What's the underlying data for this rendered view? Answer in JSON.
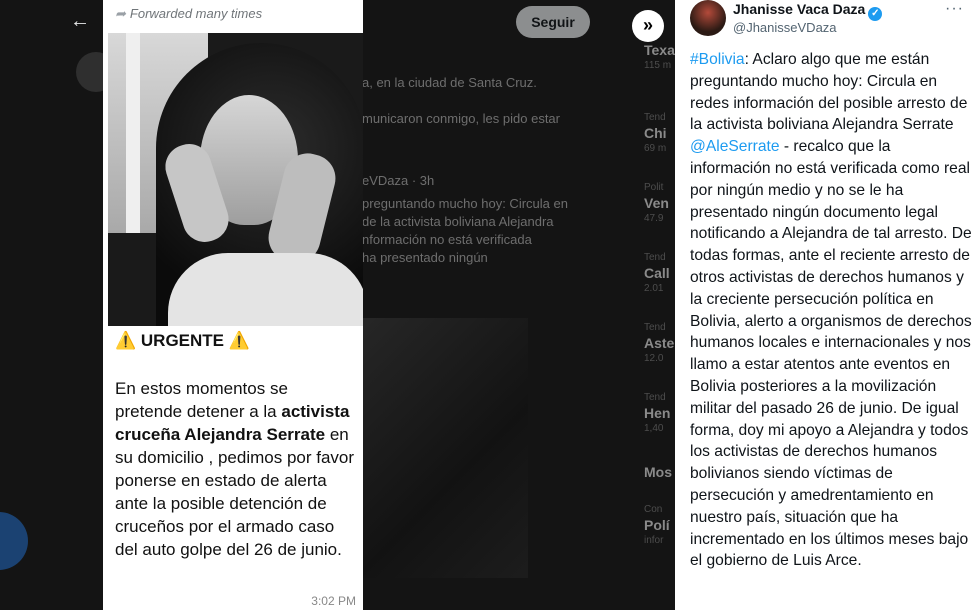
{
  "background": {
    "follow_label": "Seguir",
    "bg_line_1": "a, en la ciudad de Santa Cruz.",
    "bg_line_2": "municaron conmigo, les pido estar",
    "bg_quote_handle": "eVDaza · 3h",
    "bg_quote_1": "preguntando mucho hoy: Circula en",
    "bg_quote_2": "de la activista boliviana Alejandra",
    "bg_quote_3": "nformación no está verificada",
    "bg_quote_4": "ha presentado ningún",
    "trends": [
      {
        "cat": "",
        "name": "Texa",
        "count": "115 m"
      },
      {
        "cat": "Tend",
        "name": "Chi",
        "count": "69 m"
      },
      {
        "cat": "Polit",
        "name": "Ven",
        "count": "47.9"
      },
      {
        "cat": "Tend",
        "name": "Call",
        "count": "2.01"
      },
      {
        "cat": "Tend",
        "name": "Aste",
        "count": "12.0"
      },
      {
        "cat": "Tend",
        "name": "Hen",
        "count": "1,40"
      },
      {
        "cat": "",
        "name": "Mos",
        "count": ""
      },
      {
        "cat": "Con",
        "name": "Polí",
        "count": "infor"
      }
    ]
  },
  "telegram": {
    "forwarded": "Forwarded many times",
    "urgent_label": "URGENTE",
    "warn_icon": "⚠️",
    "msg_part1": "En estos momentos se pretende detener a la ",
    "msg_bold": "activista cruceña Alejandra Serrate",
    "msg_part2": " en su domicilio , pedimos por favor ponerse en estado de alerta ante la posible detención de cruceños por el armado caso del auto golpe del  26 de junio.",
    "time": "3:02 PM"
  },
  "tweet": {
    "name": "Jhanisse Vaca Daza",
    "handle": "@JhanisseVDaza",
    "hashtag": "#Bolivia",
    "text_part1": ": Aclaro algo que me están preguntando mucho hoy: Circula en redes información del posible arresto de la activista boliviana Alejandra Serrate ",
    "mention": "@AleSerrate",
    "text_part2": " - recalco que la información no está verificada como real por ningún medio y no se le ha presentado ningún documento legal notificando a Alejandra de tal arresto. De todas formas, ante el reciente arresto de otros activistas de derechos humanos y la creciente persecución política en Bolivia, alerto a organismos de derechos humanos locales e internacionales y nos llamo a estar atentos ante eventos en Bolivia posteriores a la movilización militar del pasado 26 de junio. De igual forma, doy mi apoyo a Alejandra y todos los activistas de derechos humanos bolivianos siendo víctimas de persecución y amedrentamiento en nuestro país, situación que ha incrementado en los últimos meses bajo el gobierno de Luis Arce."
  }
}
